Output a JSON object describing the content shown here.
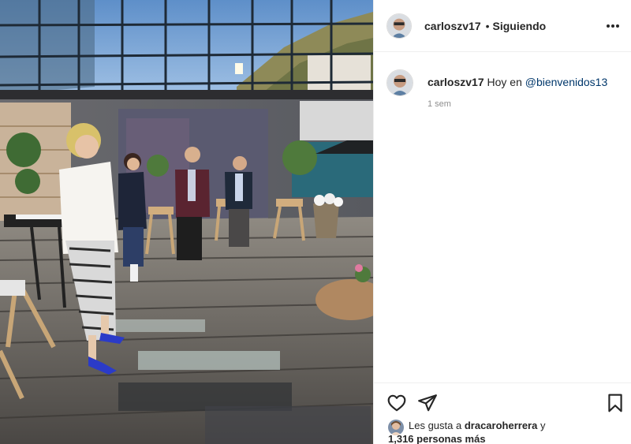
{
  "post": {
    "username": "carloszv17",
    "separator": "•",
    "follow_status": "Siguiendo",
    "more_icon": "more-horizontal-icon"
  },
  "caption": {
    "username": "carloszv17",
    "text": "Hoy en",
    "mention": "@bienvenidos13",
    "time": "1 sem"
  },
  "actions": {
    "like_icon": "heart-icon",
    "share_icon": "paper-plane-icon",
    "save_icon": "bookmark-icon"
  },
  "likes": {
    "prefix": "Les gusta a",
    "user": "dracaroherrera",
    "conj": "y",
    "count_text": "1,316 personas más"
  },
  "colors": {
    "text": "#262626",
    "muted": "#8e8e8e",
    "mention": "#00376b",
    "border": "#efefef"
  }
}
